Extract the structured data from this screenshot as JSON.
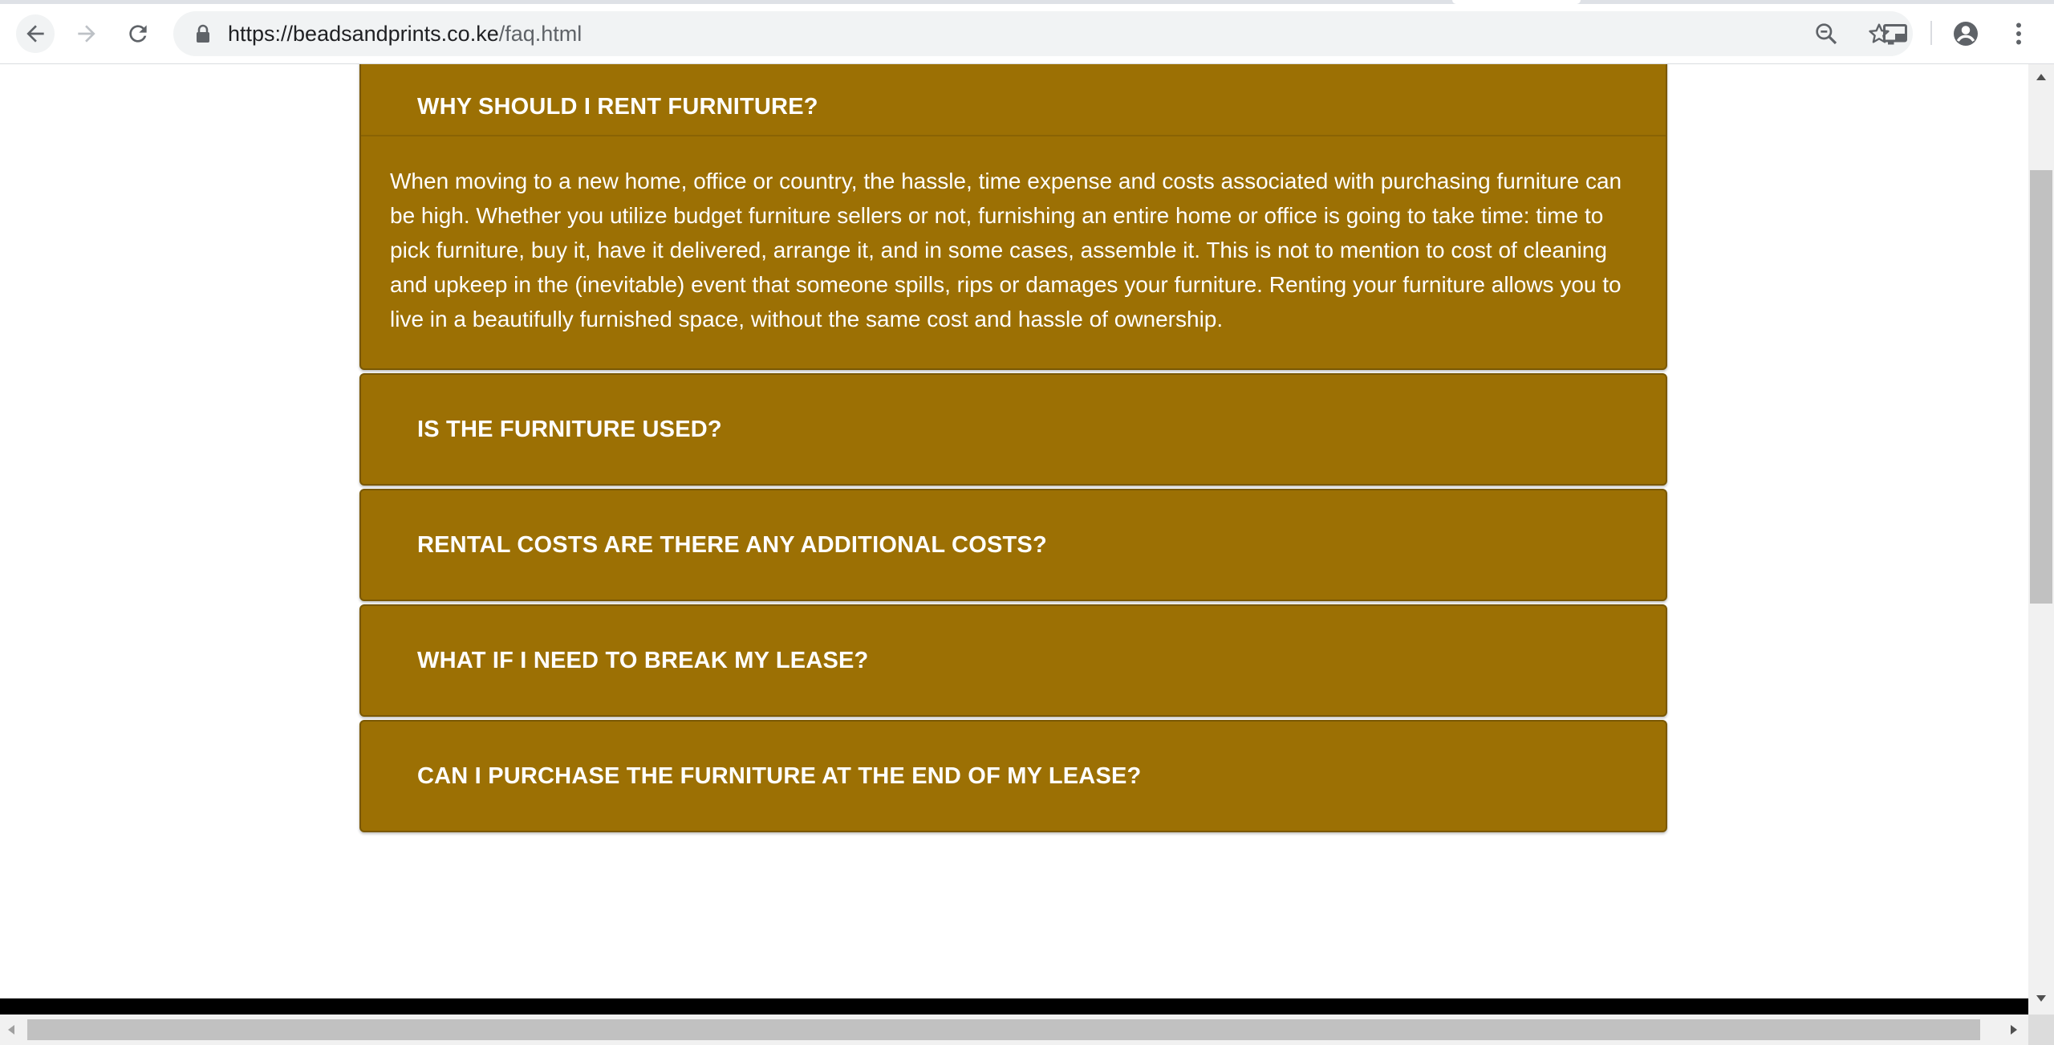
{
  "browser": {
    "url_host": "https://beadsandprints.co.ke",
    "url_path": "/faq.html",
    "icons": {
      "back": "back-arrow-icon",
      "forward": "forward-arrow-icon",
      "reload": "reload-icon",
      "lock": "lock-icon",
      "zoom": "zoom-out-icon",
      "bookmark": "star-icon",
      "cast": "cast-icon",
      "profile": "account-icon",
      "menu": "kebab-menu-icon"
    }
  },
  "faq": {
    "accent_color": "#9c7004",
    "items": [
      {
        "question": "WHY SHOULD I RENT FURNITURE?",
        "expanded": true,
        "answer": "When moving to a new home, office or country, the hassle, time expense and costs associated with purchasing furniture can be high. Whether you utilize budget furniture sellers or not, furnishing an entire home or office is going to take time: time to pick furniture, buy it, have it delivered, arrange it, and in some cases, assemble it. This is not to mention to cost of cleaning and upkeep in the (inevitable) event that someone spills, rips or damages your furniture. Renting your furniture allows you to live in a beautifully furnished space, without the same cost and hassle of ownership."
      },
      {
        "question": "IS THE FURNITURE USED?",
        "expanded": false
      },
      {
        "question": "RENTAL COSTS ARE THERE ANY ADDITIONAL COSTS?",
        "expanded": false
      },
      {
        "question": "WHAT IF I NEED TO BREAK MY LEASE?",
        "expanded": false
      },
      {
        "question": "CAN I PURCHASE THE FURNITURE AT THE END OF MY LEASE?",
        "expanded": false
      }
    ]
  }
}
